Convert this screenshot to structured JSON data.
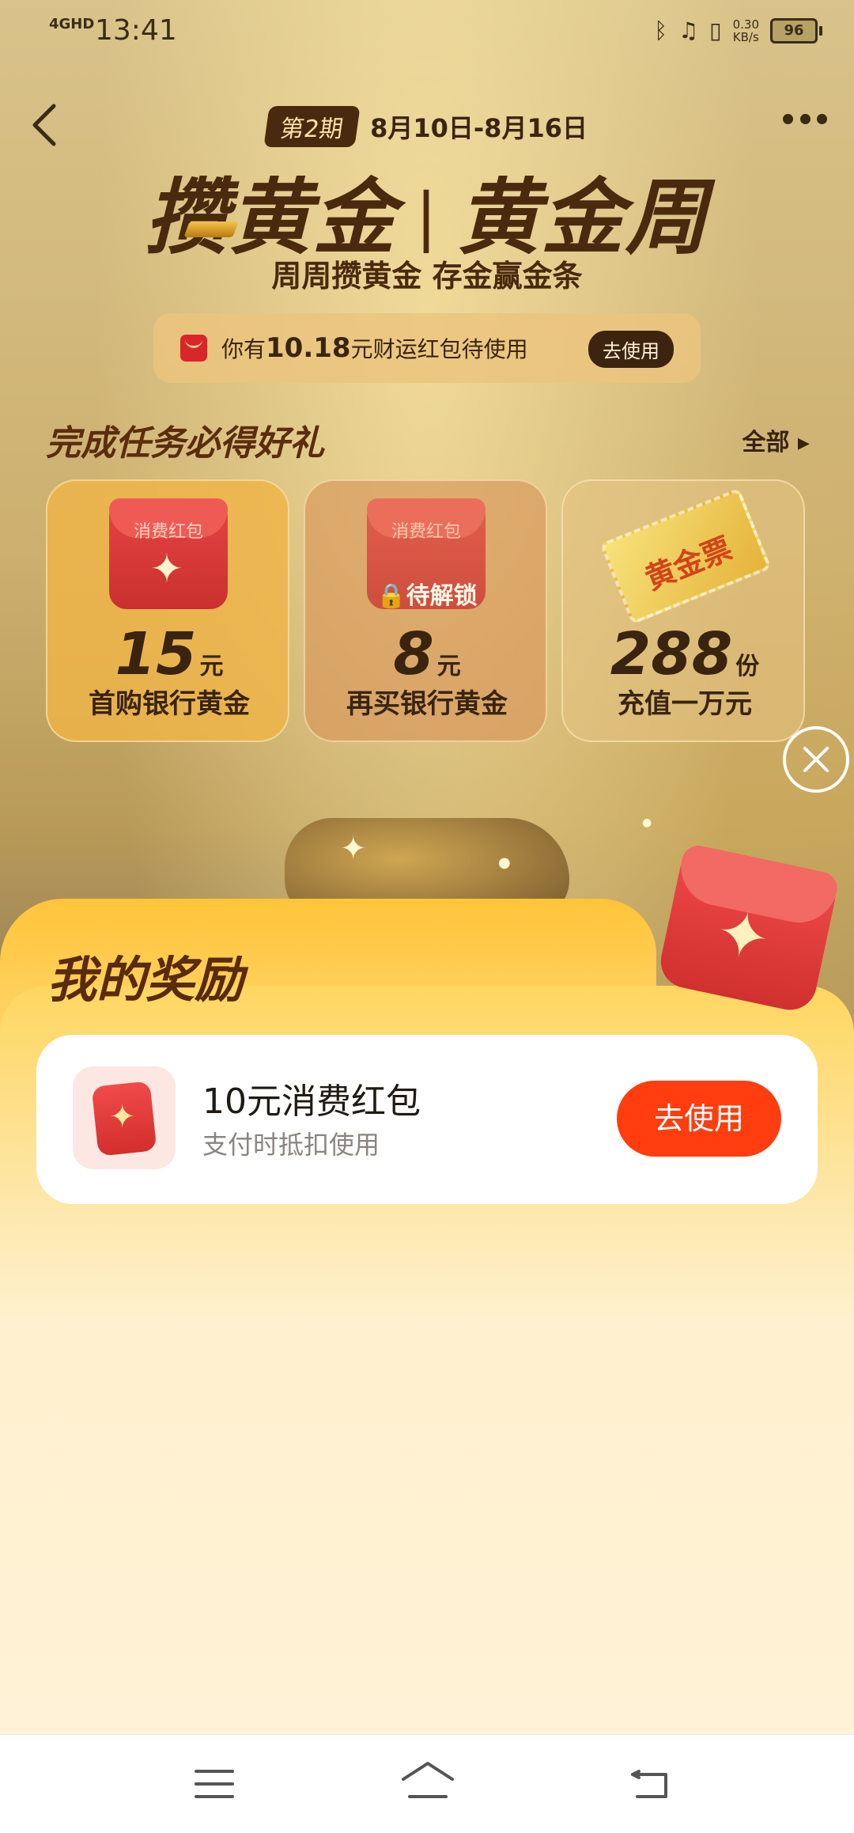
{
  "status_bar": {
    "network": "4GHD",
    "time": "13:41",
    "speed_value": "0.30",
    "speed_unit": "KB/s",
    "battery": "96"
  },
  "header": {
    "period_badge": "第2期",
    "period_dates": "8月10日-8月16日",
    "title_left": "攒黄金",
    "title_separator": "|",
    "title_right": "黄金周",
    "subtitle": "周周攒黄金 存金赢金条"
  },
  "banner": {
    "prefix": "你有",
    "amount": "10.18",
    "suffix": "元财运红包待使用",
    "button": "去使用"
  },
  "tasks": {
    "title": "完成任务必得好礼",
    "all_label": "全部",
    "cards": [
      {
        "badge": "消费红包",
        "value": "15",
        "unit": "元",
        "desc": "首购银行黄金"
      },
      {
        "badge": "消费红包",
        "lock_label": "待解锁",
        "value": "8",
        "unit": "元",
        "desc": "再买银行黄金"
      },
      {
        "badge": "黄金票",
        "value": "288",
        "unit": "份",
        "desc": "充值一万元"
      }
    ]
  },
  "rewards_sheet": {
    "title": "我的奖励",
    "items": [
      {
        "name": "10元消费红包",
        "desc": "支付时抵扣使用",
        "button": "去使用"
      }
    ]
  },
  "colors": {
    "accent_button": "#ff3d0e",
    "title_brown": "#4a2a0e",
    "sheet_yellow": "#ffc43a"
  },
  "icons": [
    "back-icon",
    "more-icon",
    "bluetooth-icon",
    "headphones-icon",
    "vibrate-icon",
    "battery-icon",
    "red-envelope-icon",
    "close-icon",
    "menu-icon",
    "home-icon",
    "nav-back-icon"
  ]
}
